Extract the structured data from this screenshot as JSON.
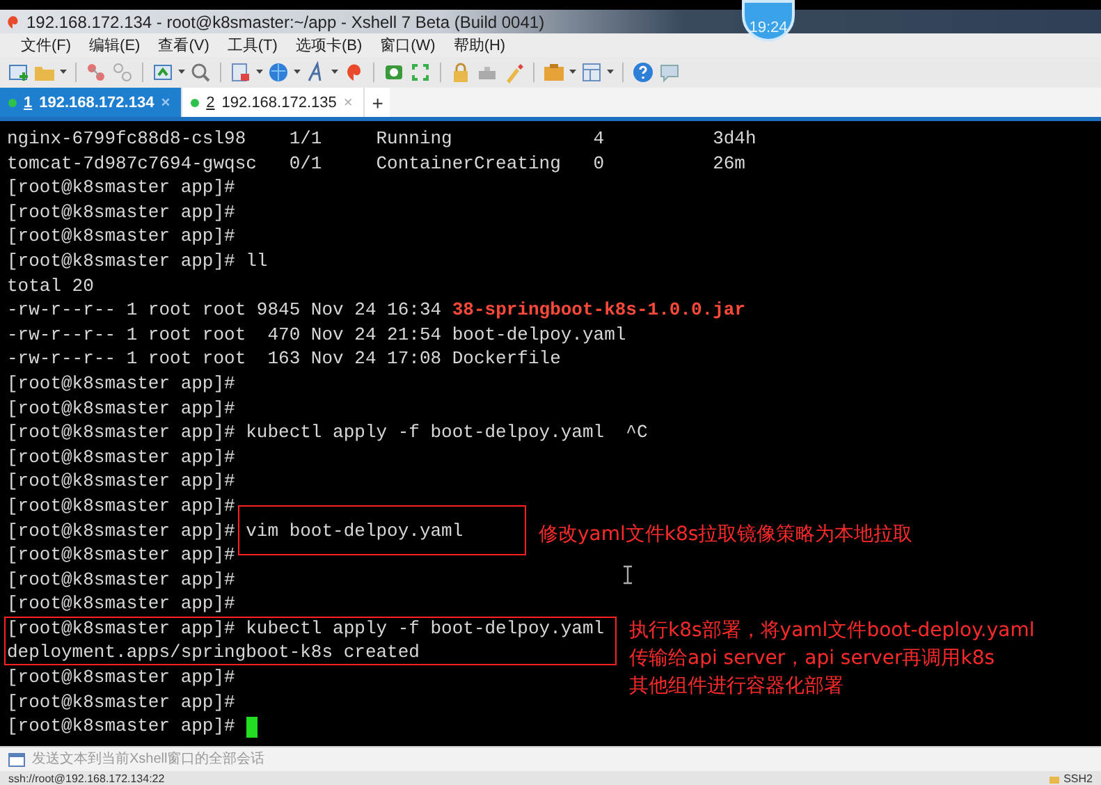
{
  "window": {
    "title": "192.168.172.134 - root@k8smaster:~/app - Xshell 7 Beta (Build 0041)"
  },
  "clock_badge": "19:24",
  "menu": [
    "文件(F)",
    "编辑(E)",
    "查看(V)",
    "工具(T)",
    "选项卡(B)",
    "窗口(W)",
    "帮助(H)"
  ],
  "tabs": [
    {
      "number": "1",
      "host": "192.168.172.134",
      "close": "×",
      "selected": true
    },
    {
      "number": "2",
      "host": "192.168.172.135",
      "close": "×",
      "selected": false
    }
  ],
  "new_tab": "+",
  "terminal": {
    "lines": [
      {
        "cursor": false,
        "segments": [
          {
            "kind": "plain",
            "text": "nginx-6799fc88d8-csl98    1/1     Running             4          3d4h"
          }
        ]
      },
      {
        "cursor": false,
        "segments": [
          {
            "kind": "plain",
            "text": "tomcat-7d987c7694-gwqsc   0/1     ContainerCreating   0          26m"
          }
        ]
      },
      {
        "cursor": false,
        "segments": [
          {
            "kind": "plain",
            "text": "[root@k8smaster app]#"
          }
        ]
      },
      {
        "cursor": false,
        "segments": [
          {
            "kind": "plain",
            "text": "[root@k8smaster app]#"
          }
        ]
      },
      {
        "cursor": false,
        "segments": [
          {
            "kind": "plain",
            "text": "[root@k8smaster app]#"
          }
        ]
      },
      {
        "cursor": false,
        "segments": [
          {
            "kind": "plain",
            "text": "[root@k8smaster app]# ll"
          }
        ]
      },
      {
        "cursor": false,
        "segments": [
          {
            "kind": "plain",
            "text": "total 20"
          }
        ]
      },
      {
        "cursor": false,
        "segments": [
          {
            "kind": "plain",
            "text": "-rw-r--r-- 1 root root 9845 Nov 24 16:34 "
          },
          {
            "kind": "archive",
            "text": "38-springboot-k8s-1.0.0.jar"
          }
        ]
      },
      {
        "cursor": false,
        "segments": [
          {
            "kind": "plain",
            "text": "-rw-r--r-- 1 root root  470 Nov 24 21:54 boot-delpoy.yaml"
          }
        ]
      },
      {
        "cursor": false,
        "segments": [
          {
            "kind": "plain",
            "text": "-rw-r--r-- 1 root root  163 Nov 24 17:08 Dockerfile"
          }
        ]
      },
      {
        "cursor": false,
        "segments": [
          {
            "kind": "plain",
            "text": "[root@k8smaster app]#"
          }
        ]
      },
      {
        "cursor": false,
        "segments": [
          {
            "kind": "plain",
            "text": "[root@k8smaster app]#"
          }
        ]
      },
      {
        "cursor": false,
        "segments": [
          {
            "kind": "plain",
            "text": "[root@k8smaster app]# kubectl apply -f boot-delpoy.yaml  ^C"
          }
        ]
      },
      {
        "cursor": false,
        "segments": [
          {
            "kind": "plain",
            "text": "[root@k8smaster app]#"
          }
        ]
      },
      {
        "cursor": false,
        "segments": [
          {
            "kind": "plain",
            "text": "[root@k8smaster app]#"
          }
        ]
      },
      {
        "cursor": false,
        "segments": [
          {
            "kind": "plain",
            "text": "[root@k8smaster app]#"
          }
        ]
      },
      {
        "cursor": false,
        "segments": [
          {
            "kind": "plain",
            "text": "[root@k8smaster app]# vim boot-delpoy.yaml"
          }
        ]
      },
      {
        "cursor": false,
        "segments": [
          {
            "kind": "plain",
            "text": "[root@k8smaster app]#"
          }
        ]
      },
      {
        "cursor": false,
        "segments": [
          {
            "kind": "plain",
            "text": "[root@k8smaster app]#"
          }
        ]
      },
      {
        "cursor": false,
        "segments": [
          {
            "kind": "plain",
            "text": "[root@k8smaster app]#"
          }
        ]
      },
      {
        "cursor": false,
        "segments": [
          {
            "kind": "plain",
            "text": "[root@k8smaster app]# kubectl apply -f boot-delpoy.yaml"
          }
        ]
      },
      {
        "cursor": false,
        "segments": [
          {
            "kind": "plain",
            "text": "deployment.apps/springboot-k8s created"
          }
        ]
      },
      {
        "cursor": false,
        "segments": [
          {
            "kind": "plain",
            "text": "[root@k8smaster app]#"
          }
        ]
      },
      {
        "cursor": false,
        "segments": [
          {
            "kind": "plain",
            "text": "[root@k8smaster app]#"
          }
        ]
      },
      {
        "cursor": true,
        "segments": [
          {
            "kind": "plain",
            "text": "[root@k8smaster app]# "
          }
        ]
      }
    ]
  },
  "annotations": [
    {
      "lines": [
        "修改yaml文件k8s拉取镜像策略为本地拉取"
      ]
    },
    {
      "lines": [
        "执行k8s部署，将yaml文件boot-deploy.yaml",
        "传输给api server，api server再调用k8s",
        "其他组件进行容器化部署"
      ]
    }
  ],
  "compose_bar": {
    "placeholder": "发送文本到当前Xshell窗口的全部会话"
  },
  "status_bar": {
    "connection": "ssh://root@192.168.172.134:22",
    "protocol": "SSH2"
  }
}
